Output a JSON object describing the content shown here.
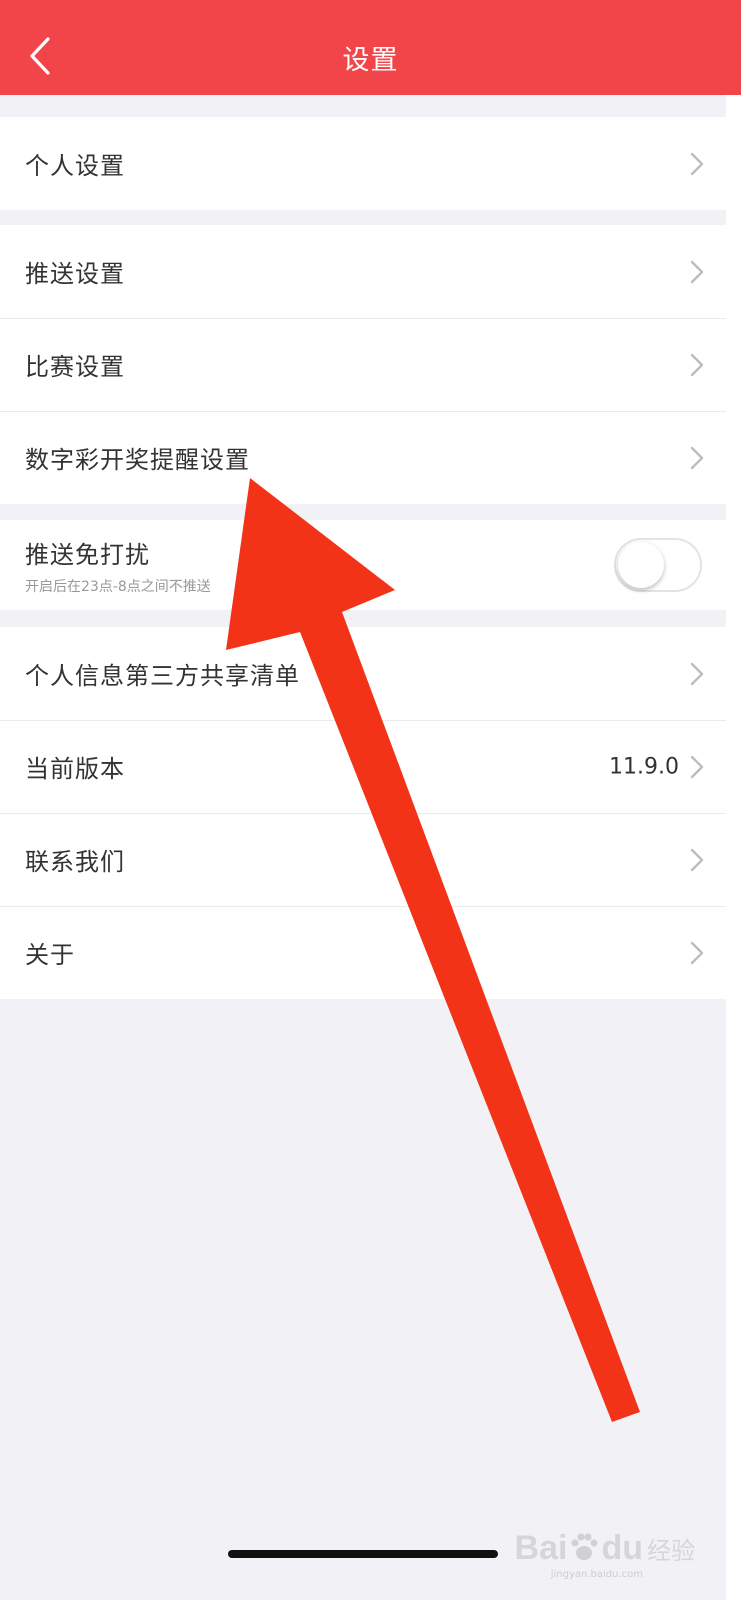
{
  "header": {
    "title": "设置",
    "back_icon": "chevron-left-icon",
    "color": "#f2454a"
  },
  "groups": {
    "g1": {
      "personal": "个人设置"
    },
    "g2": {
      "push": "推送设置",
      "match": "比赛设置",
      "lottery": "数字彩开奖提醒设置"
    },
    "g3": {
      "dnd_title": "推送免打扰",
      "dnd_desc": "开启后在23点-8点之间不推送",
      "dnd_enabled": false
    },
    "g4": {
      "share_list": "个人信息第三方共享清单",
      "version_label": "当前版本",
      "version_value": "11.9.0",
      "contact": "联系我们",
      "about": "关于"
    }
  },
  "watermark": {
    "logo": "Bai",
    "logo2": "du",
    "text": "经验",
    "sub": "jingyan.baidu.com"
  },
  "annotation": {
    "arrow_color": "#f33318"
  }
}
